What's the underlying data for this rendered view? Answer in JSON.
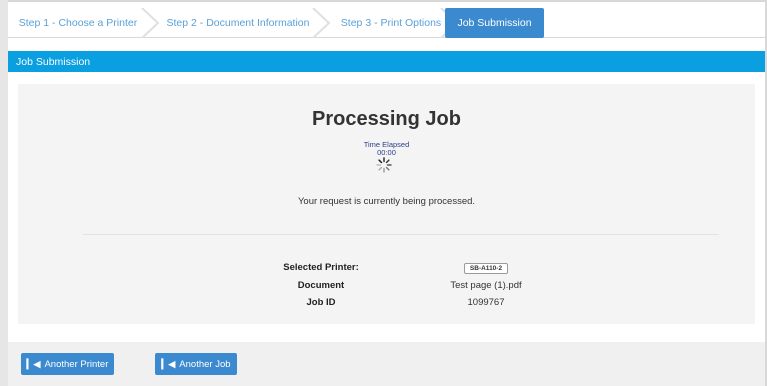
{
  "wizard": {
    "steps": [
      {
        "label": "Step 1 - Choose a Printer"
      },
      {
        "label": "Step 2 - Document Information"
      },
      {
        "label": "Step 3 - Print Options"
      },
      {
        "label": "Job Submission"
      }
    ]
  },
  "panel": {
    "header": "Job Submission"
  },
  "processing": {
    "title": "Processing Job",
    "elapsed_label": "Time Elapsed",
    "elapsed_value": "00:00",
    "message": "Your request is currently being processed."
  },
  "details": {
    "printer_label": "Selected Printer:",
    "printer_value": "SB-A110-2",
    "document_label": "Document",
    "document_value": "Test page (1).pdf",
    "job_label": "Job ID",
    "job_value": "1099767"
  },
  "footer": {
    "another_printer": "Another Printer",
    "another_job": "Another Job"
  },
  "colors": {
    "accent": "#3b89cf",
    "header_bar": "#0a9fe0",
    "step_text": "#5aa0d8"
  },
  "icons": {
    "spinner": "loading-spinner-icon",
    "back": "skip-back-icon"
  }
}
